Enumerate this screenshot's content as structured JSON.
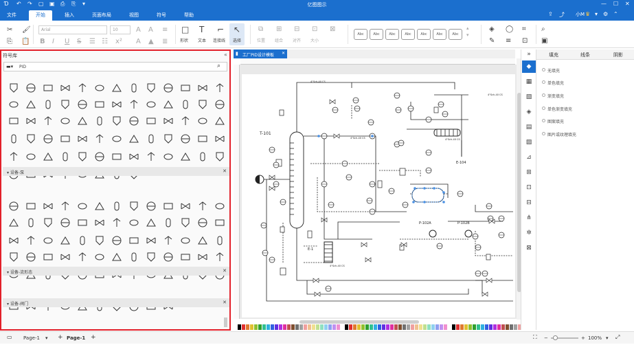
{
  "app": {
    "title": "亿图图示"
  },
  "menu": {
    "items": [
      "文件",
      "开始",
      "插入",
      "页面布局",
      "视图",
      "符号",
      "帮助"
    ],
    "active": "开始",
    "user": "小M"
  },
  "ribbon": {
    "font_family": "Arial",
    "font_size": "10",
    "shape_label": "形状",
    "text_label": "文本",
    "connector_label": "连接线",
    "select_label": "选择",
    "position_label": "位置",
    "group_label": "组合",
    "align_label": "对齐",
    "size_label": "大小",
    "style_boxes": [
      "Abc",
      "Abc",
      "Abc",
      "Abc",
      "Abc",
      "Abc",
      "Abc"
    ]
  },
  "library": {
    "title": "符号库",
    "search_value": "PID",
    "categories": [
      "设备-泵",
      "设备-流形态",
      "设备-阀门"
    ]
  },
  "document": {
    "tab_title": "工厂PID设计模板"
  },
  "diagram_labels": {
    "t101": "T-101",
    "e101": "E-101",
    "e104": "E-104",
    "p102a": "P-102A",
    "p102b": "P-102B",
    "spec1": "4\"Sch-40 CS",
    "spec2": "4\"Sch-40 CS",
    "spec3": "4\"Sch-40 CS",
    "spec4": "4\"Sch-40 CS",
    "spec5": "4\"Sch-40 CS"
  },
  "right_panel": {
    "tabs": [
      "填充",
      "线条",
      "阴影"
    ],
    "active_tab": "填充",
    "options": [
      "无填充",
      "单色填充",
      "渐变填充",
      "单色渐变填充",
      "图案填充",
      "图片或纹理填充"
    ]
  },
  "status": {
    "page_selector": "Page-1",
    "active_page": "Page-1",
    "zoom": "100%"
  },
  "colors": {
    "accent": "#1b6fce",
    "highlight": "#e2202a"
  }
}
